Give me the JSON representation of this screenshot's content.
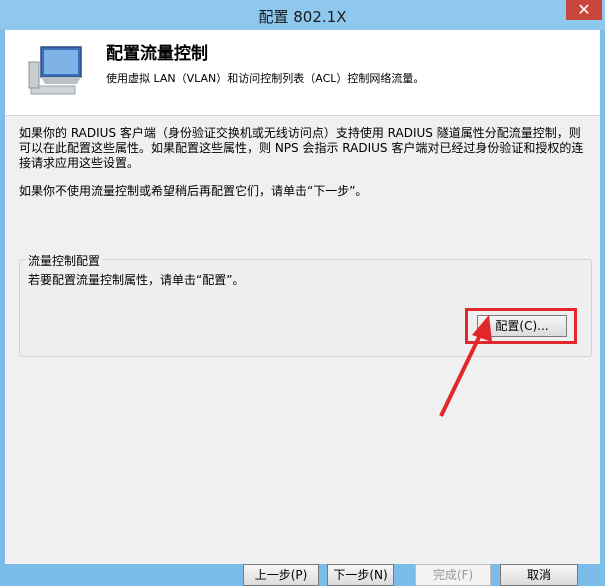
{
  "window": {
    "title": "配置 802.1X",
    "close_label": "✕"
  },
  "header": {
    "title": "配置流量控制",
    "subtitle": "使用虚拟 LAN（VLAN）和访问控制列表（ACL）控制网络流量。"
  },
  "body": {
    "para1": "如果你的 RADIUS 客户端（身份验证交换机或无线访问点）支持使用 RADIUS 隧道属性分配流量控制，则可以在此配置这些属性。如果配置这些属性，则 NPS 会指示 RADIUS 客户端对已经过身份验证和授权的连接请求应用这些设置。",
    "para2": "如果你不使用流量控制或希望稍后再配置它们，请单击“下一步”。"
  },
  "group": {
    "label": "流量控制配置",
    "text": "若要配置流量控制属性，请单击“配置”。",
    "configure_button": "配置(C)..."
  },
  "footer": {
    "prev_button": "上一步(P)",
    "next_button": "下一步(N)",
    "finish_button": "完成(F)",
    "cancel_button": "取消"
  },
  "colors": {
    "highlight": "#e0282a",
    "titlebar": "#8fc8ef",
    "close": "#c7453a"
  }
}
